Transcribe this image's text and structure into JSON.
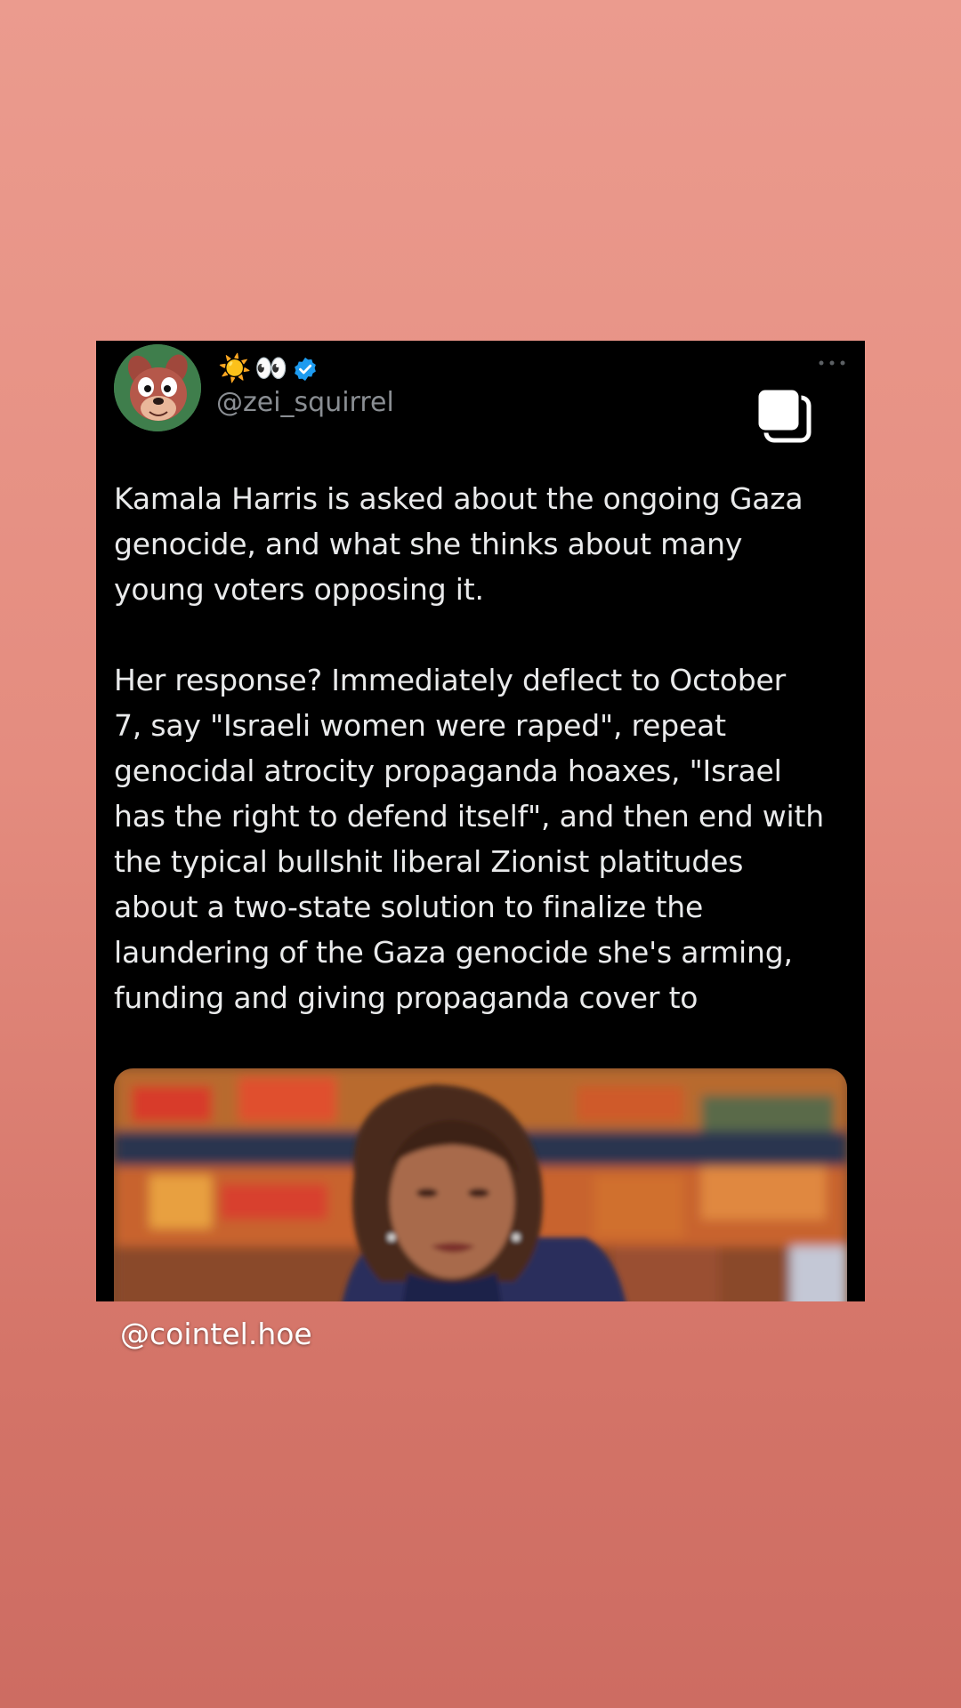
{
  "tweet": {
    "display_emojis": [
      "☀️",
      "👀"
    ],
    "verified_icon": "verified-badge-icon",
    "handle": "@zei_squirrel",
    "paragraphs": [
      "Kamala Harris is asked about the ongoing Gaza\ngenocide, and what she thinks about many\nyoung voters opposing it.",
      "Her response? Immediately deflect to October\n7, say \"Israeli women were raped\", repeat\ngenocidal atrocity propaganda hoaxes, \"Israel\nhas the right to defend itself\", and then end with\nthe typical bullshit liberal Zionist platitudes\nabout a two-state solution to finalize the\nlaundering of the Gaza genocide she's arming,\nfunding and giving propaganda cover to"
    ],
    "icons": {
      "more": "more-dots-icon",
      "media_stack": "multiple-media-icon"
    }
  },
  "story": {
    "caption": "@cointel.hoe"
  },
  "colors": {
    "background_top": "#eb9b8e",
    "background_bottom": "#cd6c62",
    "card": "#000000",
    "text": "#e9eaeb",
    "handle": "#8a8e93",
    "verified": "#1d9bf0"
  }
}
